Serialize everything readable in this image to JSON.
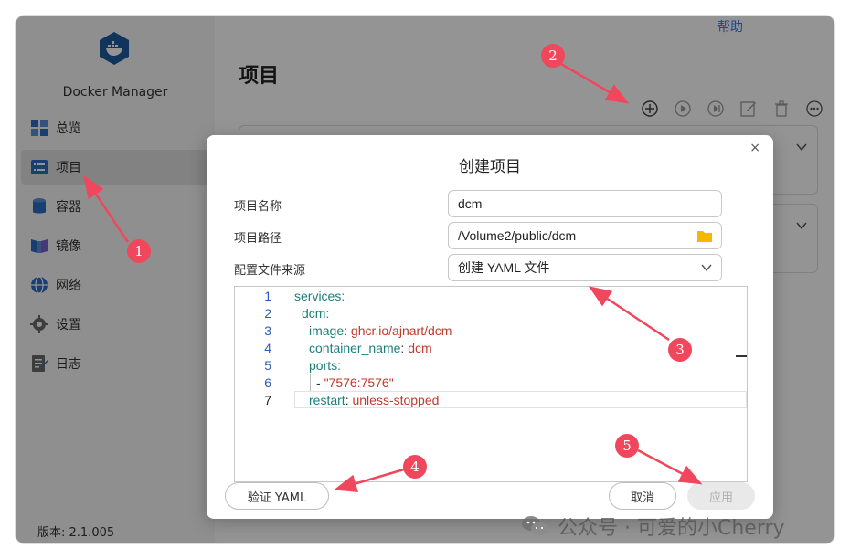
{
  "app": {
    "name": "Docker Manager",
    "version": "版本: 2.1.005",
    "help_label": "帮助"
  },
  "sidebar": {
    "items": [
      {
        "label": "总览",
        "icon": "overview-icon"
      },
      {
        "label": "项目",
        "icon": "project-list-icon",
        "active": true
      },
      {
        "label": "容器",
        "icon": "container-icon"
      },
      {
        "label": "镜像",
        "icon": "image-icon"
      },
      {
        "label": "网络",
        "icon": "network-globe-icon"
      },
      {
        "label": "设置",
        "icon": "gear-icon"
      },
      {
        "label": "日志",
        "icon": "log-icon"
      }
    ]
  },
  "main": {
    "title": "项目",
    "toolbar": [
      "add-icon",
      "start-icon",
      "restart-icon",
      "edit-icon",
      "delete-icon",
      "more-icon"
    ]
  },
  "dialog": {
    "title": "创建项目",
    "close": "×",
    "fields": {
      "name_label": "项目名称",
      "name_value": "dcm",
      "path_label": "项目路径",
      "path_value": "/Volume2/public/dcm",
      "source_label": "配置文件来源",
      "source_value": "创建 YAML 文件"
    },
    "editor_lines": [
      {
        "n": "1",
        "key": "services",
        "sep": ":",
        "val": ""
      },
      {
        "n": "2",
        "key": "dcm",
        "sep": ":",
        "val": ""
      },
      {
        "n": "3",
        "key": "image",
        "sep": ": ",
        "val": "ghcr.io/ajnart/dcm"
      },
      {
        "n": "4",
        "key": "container_name",
        "sep": ": ",
        "val": "dcm"
      },
      {
        "n": "5",
        "key": "ports",
        "sep": ":",
        "val": ""
      },
      {
        "n": "6",
        "key": "- ",
        "sep": "",
        "val": "\"7576:7576\""
      },
      {
        "n": "7",
        "key": "restart",
        "sep": ": ",
        "val": "unless-stopped"
      }
    ],
    "buttons": {
      "validate": "验证 YAML",
      "cancel": "取消",
      "apply": "应用"
    }
  },
  "annotations": {
    "markers": [
      "1",
      "2",
      "3",
      "4",
      "5"
    ],
    "color": "#f0475c"
  },
  "watermark": "公众号 · 可爱的小Cherry"
}
